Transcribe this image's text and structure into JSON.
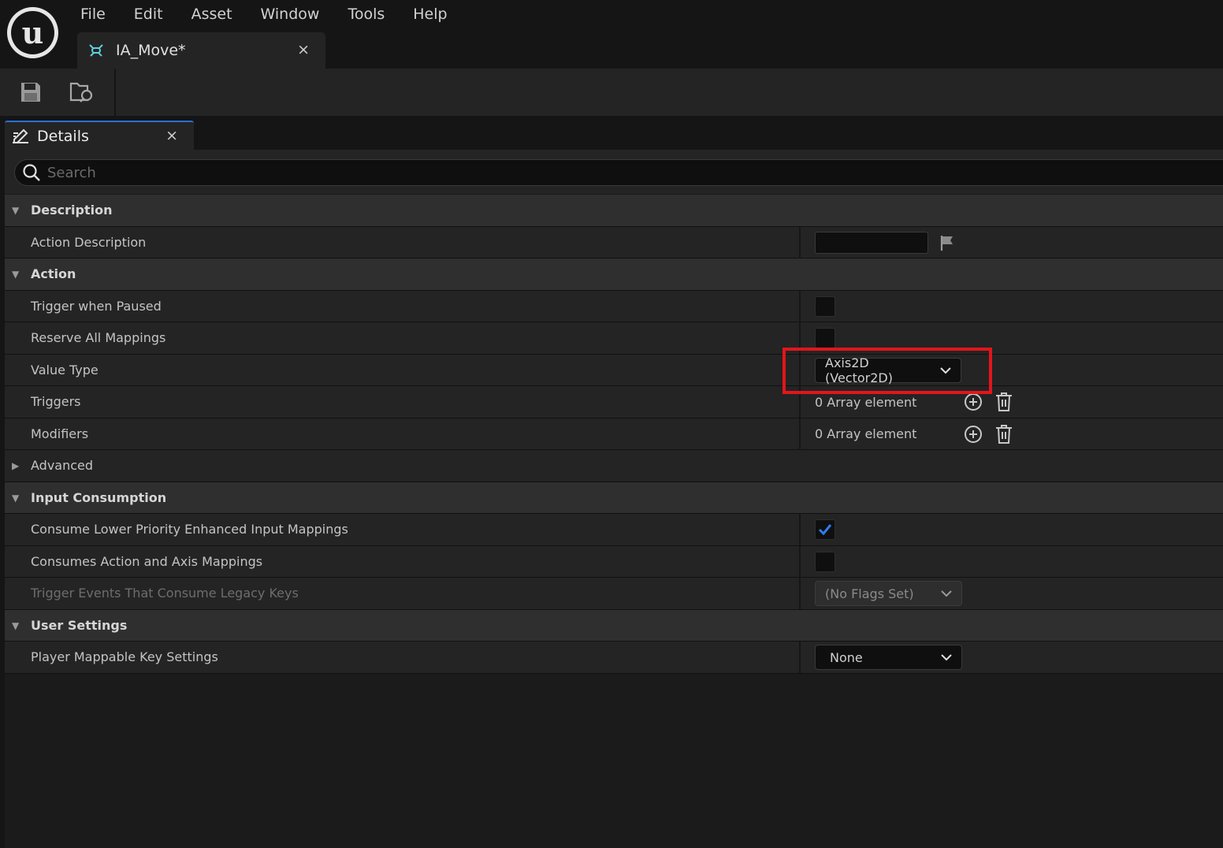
{
  "menu": [
    "File",
    "Edit",
    "Asset",
    "Window",
    "Tools",
    "Help"
  ],
  "document_tab": {
    "label": "IA_Move*",
    "close": "×"
  },
  "details_tab": {
    "label": "Details",
    "close": "×"
  },
  "search": {
    "placeholder": "Search",
    "value": ""
  },
  "sections": {
    "description": {
      "label": "Description",
      "action_description": "Action Description"
    },
    "action": {
      "label": "Action",
      "trigger_when_paused": "Trigger when Paused",
      "reserve_all_mappings": "Reserve All Mappings",
      "value_type": "Value Type",
      "value_type_value": "Axis2D (Vector2D)",
      "triggers": "Triggers",
      "triggers_value": "0 Array element",
      "modifiers": "Modifiers",
      "modifiers_value": "0 Array element",
      "advanced": "Advanced"
    },
    "input_consumption": {
      "label": "Input Consumption",
      "consume_lower_priority": "Consume Lower Priority Enhanced Input Mappings",
      "consumes_action_axis": "Consumes Action and Axis Mappings",
      "trigger_events_legacy": "Trigger Events That Consume Legacy Keys",
      "trigger_events_legacy_value": "(No Flags Set)"
    },
    "user_settings": {
      "label": "User Settings",
      "player_mappable": "Player Mappable Key Settings",
      "player_mappable_value": "None"
    }
  },
  "states": {
    "trigger_when_paused": false,
    "reserve_all_mappings": false,
    "consume_lower_priority": true,
    "consumes_action_axis": false
  },
  "colors": {
    "accent": "#2a6fd6",
    "highlight": "#e3151a",
    "check": "#2f7bf0"
  }
}
